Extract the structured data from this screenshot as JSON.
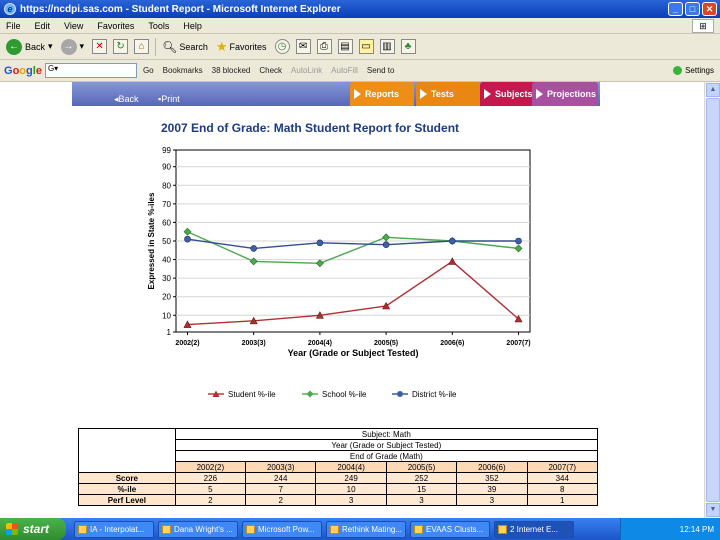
{
  "window": {
    "title": "https://ncdpi.sas.com - Student Report - Microsoft Internet Explorer",
    "minimize": "_",
    "maximize": "□",
    "close": "✕"
  },
  "menu": [
    "File",
    "Edit",
    "View",
    "Favorites",
    "Tools",
    "Help"
  ],
  "toolbar": {
    "back": "Back",
    "search": "Search",
    "favorites": "Favorites"
  },
  "google_toolbar": {
    "logo": [
      "G",
      "o",
      "o",
      "g",
      "l",
      "e"
    ],
    "items": [
      "Go",
      "Bookmarks",
      "38 blocked",
      "Check",
      "AutoLink",
      "AutoFill",
      "Send to"
    ],
    "settings": "Settings"
  },
  "nav": {
    "back": "Back",
    "print": "Print",
    "tabs": [
      "Reports",
      "Tests",
      "Subjects",
      "Projections"
    ]
  },
  "report_title": "2007 End of Grade: Math Student Report for Student",
  "chart_data": {
    "type": "line",
    "categories": [
      "2002(2)",
      "2003(3)",
      "2004(4)",
      "2005(5)",
      "2006(6)",
      "2007(7)"
    ],
    "series": [
      {
        "name": "Student %-ile",
        "values": [
          5,
          7,
          10,
          15,
          39,
          8
        ],
        "color": "#b03030",
        "marker": "triangle"
      },
      {
        "name": "School %-ile",
        "values": [
          55,
          39,
          38,
          52,
          50,
          46
        ],
        "color": "#4ca84c",
        "marker": "diamond"
      },
      {
        "name": "District %-ile",
        "values": [
          51,
          46,
          49,
          48,
          50,
          50
        ],
        "color": "#2f4f8f",
        "marker": "circle"
      }
    ],
    "yticks": [
      1,
      10,
      20,
      30,
      40,
      50,
      60,
      70,
      80,
      90,
      99
    ],
    "ylim": [
      1,
      99
    ],
    "xlabel": "Year (Grade or Subject Tested)",
    "ylabel": "Expressed in State %-iles",
    "grid": true,
    "legend_position": "bottom"
  },
  "table": {
    "subject": "Subject: Math",
    "year_header": "Year (Grade or Subject Tested)",
    "test_header": "End of Grade (Math)",
    "years": [
      "2002(2)",
      "2003(3)",
      "2004(4)",
      "2005(5)",
      "2006(6)",
      "2007(7)"
    ],
    "rows": [
      {
        "label": "Score",
        "values": [
          "226",
          "244",
          "249",
          "252",
          "352",
          "344"
        ]
      },
      {
        "label": "%-ile",
        "values": [
          "5",
          "7",
          "10",
          "15",
          "39",
          "8"
        ]
      },
      {
        "label": "Perf Level",
        "values": [
          "2",
          "2",
          "3",
          "3",
          "3",
          "1"
        ]
      }
    ]
  },
  "taskbar": {
    "start": "start",
    "tasks": [
      "IA - Interpolat...",
      "Dana Wright's ...",
      "Microsoft Pow...",
      "Rethink Mating...",
      "EVAAS Clusts...",
      "2 Internet E..."
    ],
    "clock": "12:14 PM"
  }
}
